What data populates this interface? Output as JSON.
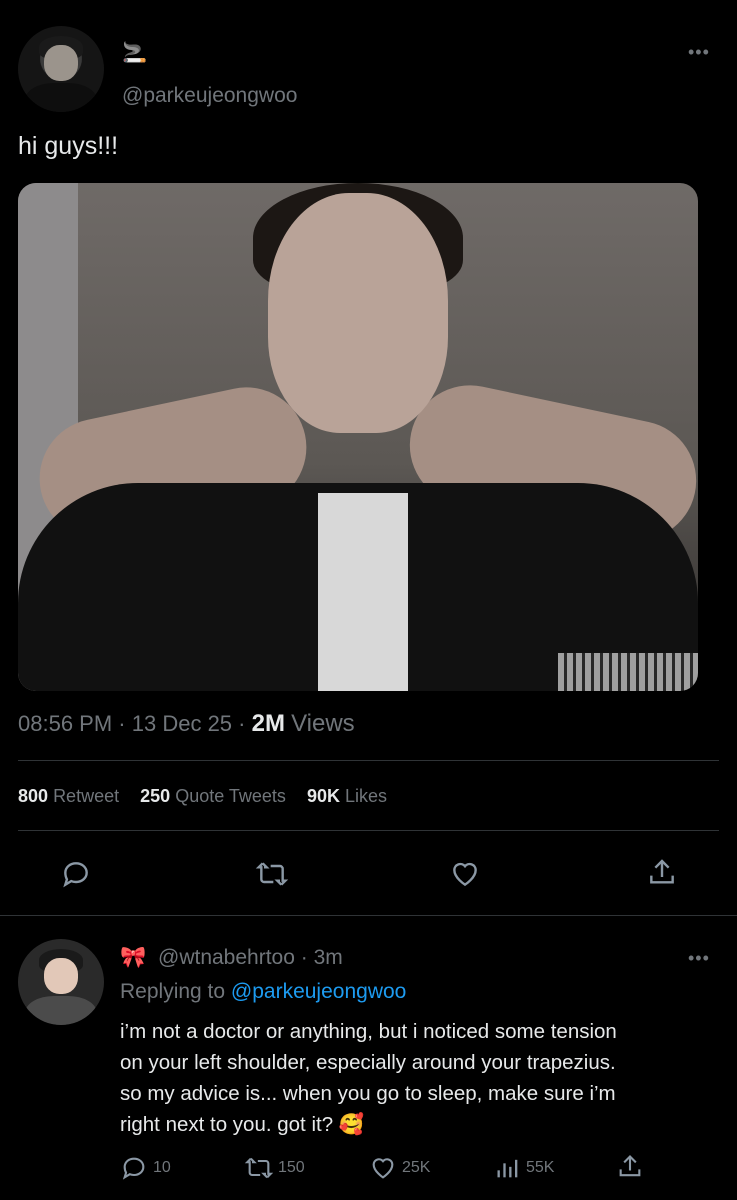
{
  "post": {
    "display_name": "🚬",
    "handle": "@parkeujeongwoo",
    "more": "•••",
    "text": "hi guys!!!",
    "time": "08:56 PM",
    "sep1": "·",
    "date": "13 Dec 25",
    "sep2": "·",
    "views_count": "2M",
    "views_label": "Views",
    "stats": {
      "retweets_count": "800",
      "retweets_label": "Retweet",
      "quotes_count": "250",
      "quotes_label": "Quote Tweets",
      "likes_count": "90K",
      "likes_label": "Likes"
    }
  },
  "reply": {
    "display_name": "🎀",
    "handle": "@wtnabehrtoo",
    "sep": "·",
    "time": "3m",
    "more": "•••",
    "replying_prefix": "Replying to",
    "replying_handle": "@parkeujeongwoo",
    "text_line1": "i’m not a doctor or anything, but i noticed some tension",
    "text_line2": "on your left shoulder, especially around your trapezius.",
    "text_line3": "so my advice is... when you go to sleep, make sure i’m",
    "text_line4": "right next to you. got it? 🥰",
    "actions": {
      "replies": "10",
      "retweets": "150",
      "likes": "25K",
      "views": "55K"
    }
  },
  "colors": {
    "link": "#1d9bf0",
    "muted": "#71767b",
    "divider": "#2f3336"
  }
}
